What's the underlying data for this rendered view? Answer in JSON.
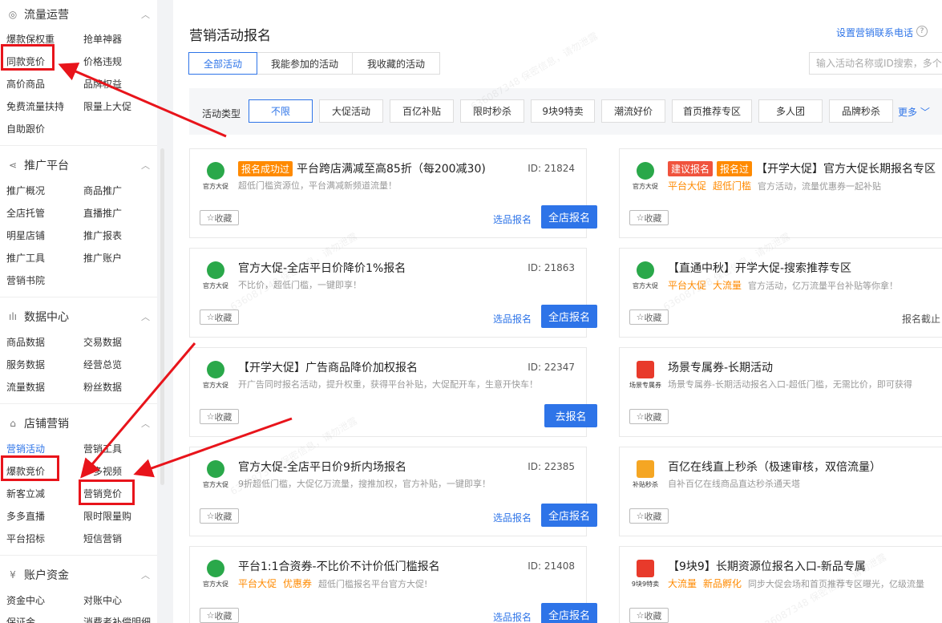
{
  "sidebar": {
    "sections": [
      {
        "title": "流量运营",
        "icon": "flow-icon",
        "items": [
          "爆款保权重",
          "抢单神器",
          "同款竞价",
          "价格违规",
          "高价商品",
          "品牌权益",
          "免费流量扶持",
          "限量上大促",
          "自助跟价"
        ]
      },
      {
        "title": "推广平台",
        "icon": "share-icon",
        "items": [
          "推广概况",
          "商品推广",
          "全店托管",
          "直播推广",
          "明星店铺",
          "推广报表",
          "推广工具",
          "推广账户",
          "营销书院"
        ]
      },
      {
        "title": "数据中心",
        "icon": "bar-chart-icon",
        "items": [
          "商品数据",
          "交易数据",
          "服务数据",
          "经营总览",
          "流量数据",
          "粉丝数据"
        ]
      },
      {
        "title": "店铺营销",
        "icon": "shop-icon",
        "items": [
          "营销活动",
          "营销工具",
          "爆款竞价",
          "多多视频",
          "新客立减",
          "营销竞价",
          "多多直播",
          "限时限量购",
          "平台招标",
          "短信营销"
        ]
      },
      {
        "title": "账户资金",
        "icon": "yen-icon",
        "items": [
          "资金中心",
          "对账中心",
          "保证金",
          "消费者补偿明细"
        ]
      }
    ]
  },
  "header": {
    "title": "营销活动报名",
    "phone_link": "设置营销联系电话",
    "help": "?"
  },
  "tabs": [
    "全部活动",
    "我能参加的活动",
    "我收藏的活动"
  ],
  "search": {
    "placeholder": "输入活动名称或ID搜索，多个"
  },
  "filter": {
    "label": "活动类型",
    "chips": [
      "不限",
      "大促活动",
      "百亿补贴",
      "限时秒杀",
      "9块9特卖",
      "潮流好价",
      "首页推荐专区",
      "多人团",
      "品牌秒杀"
    ],
    "more": "更多"
  },
  "cards_left": [
    {
      "logo": "官方大促",
      "badges": [
        "报名成功过"
      ],
      "title": "平台跨店满减至高85折（每200减30)",
      "id": "ID: 21824",
      "desc": "超低门槛资源位，平台满减新频道流量！",
      "tags": [],
      "fav": "收藏",
      "link": "选品报名",
      "button": "全店报名"
    },
    {
      "logo": "官方大促",
      "badges": [],
      "title": "官方大促-全店平日价降价1%报名",
      "id": "ID: 21863",
      "desc": "不比价，超低门槛，一键即享！",
      "tags": [],
      "fav": "收藏",
      "link": "选品报名",
      "button": "全店报名"
    },
    {
      "logo": "官方大促",
      "badges": [],
      "title": "【开学大促】广告商品降价加权报名",
      "id": "ID: 22347",
      "desc": "开广告同时报名活动，提升权重，获得平台补贴，大促配开车，生意开快车！",
      "tags": [],
      "fav": "收藏",
      "link": "",
      "button": "去报名"
    },
    {
      "logo": "官方大促",
      "badges": [],
      "title": "官方大促-全店平日价9折内场报名",
      "id": "ID: 22385",
      "desc": "9折超低门槛，大促亿万流量，搜推加权，官方补贴，一键即享！",
      "tags": [],
      "fav": "收藏",
      "link": "选品报名",
      "button": "全店报名"
    },
    {
      "logo": "官方大促",
      "badges": [],
      "title": "平台1:1合资券-不比价不计价低门槛报名",
      "id": "ID: 21408",
      "desc": "超低门槛报名平台官方大促!",
      "tags": [
        "平台大促",
        "优惠券"
      ],
      "fav": "收藏",
      "link": "选品报名",
      "button": "全店报名"
    }
  ],
  "cards_right": [
    {
      "logo": "官方大促",
      "badges": [
        "建议报名",
        "报名过"
      ],
      "title": "【开学大促】官方大促长期报名专区",
      "desc": "官方活动，流量优惠券一起补贴",
      "tags": [
        "平台大促",
        "超低门槛"
      ],
      "fav": "收藏",
      "deadline": ""
    },
    {
      "logo": "官方大促",
      "badges": [],
      "title": "【直通中秋】开学大促-搜索推荐专区",
      "desc": "官方活动，亿万流量平台补贴等你拿！",
      "tags": [
        "平台大促",
        "大流量"
      ],
      "fav": "收藏",
      "deadline": "报名截止"
    },
    {
      "logo": "场景专属券",
      "badges": [],
      "title": "场景专属券-长期活动",
      "desc": "场景专属券-长期活动报名入口-超低门槛，无需比价，即可获得",
      "tags": [],
      "fav": "收藏",
      "deadline": ""
    },
    {
      "logo": "补贴秒杀",
      "badges": [],
      "title": "百亿在线直上秒杀（极速审核，双倍流量）",
      "desc": "自补百亿在线商品直达秒杀通天塔",
      "tags": [],
      "fav": "收藏",
      "deadline": ""
    },
    {
      "logo": "9块9特卖",
      "badges": [],
      "title": "【9块9】长期资源位报名入口-新品专属",
      "desc": "同步大促会场和首页推荐专区曝光，亿级流量",
      "tags": [
        "大流量",
        "新品孵化"
      ],
      "fav": "收藏",
      "deadline": ""
    }
  ],
  "watermark": "636087348 保密信息，请勿泄露",
  "colors": {
    "accent": "#2e74e8",
    "orange": "#ff8a00",
    "red_badge": "#f0533d",
    "annotation": "#e8141b"
  }
}
